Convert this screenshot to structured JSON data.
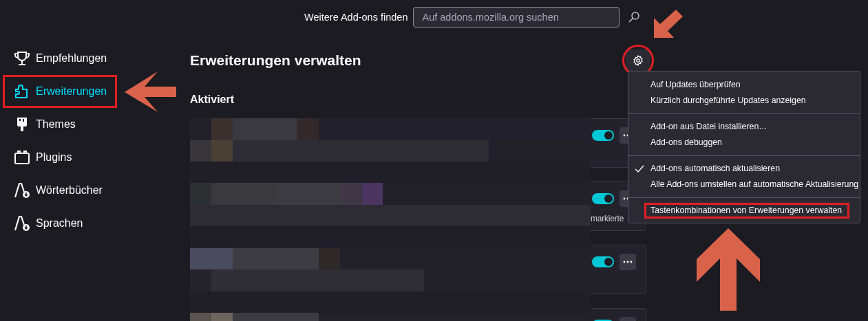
{
  "header": {
    "label": "Weitere Add-ons finden",
    "search": {
      "placeholder": "Auf addons.mozilla.org suchen"
    }
  },
  "sidebar": {
    "items": [
      {
        "label": "Empfehlungen",
        "kind": "trophy",
        "selected": false,
        "annotated": false
      },
      {
        "label": "Erweiterungen",
        "kind": "puzzle",
        "selected": true,
        "annotated": true
      },
      {
        "label": "Themes",
        "kind": "brush",
        "selected": false,
        "annotated": false
      },
      {
        "label": "Plugins",
        "kind": "plugin",
        "selected": false,
        "annotated": false
      },
      {
        "label": "Wörterbücher",
        "kind": "dictionary",
        "selected": false,
        "annotated": false
      },
      {
        "label": "Sprachen",
        "kind": "dictionary",
        "selected": false,
        "annotated": false
      }
    ]
  },
  "main": {
    "title": "Erweiterungen verwalten",
    "gear_annotated": true,
    "section": "Aktiviert",
    "cards": [
      {
        "on": true
      },
      {
        "on": true,
        "text": "markierte"
      },
      {
        "on": true
      },
      {
        "on": true
      }
    ]
  },
  "menu": {
    "groups": [
      [
        {
          "label": "Auf Updates überprüfen",
          "checked": false,
          "annotated": false
        },
        {
          "label": "Kürzlich durchgeführte Updates anzeigen",
          "checked": false,
          "annotated": false
        }
      ],
      [
        {
          "label": "Add-on aus Datei installieren…",
          "checked": false,
          "annotated": false
        },
        {
          "label": "Add-ons debuggen",
          "checked": false,
          "annotated": false
        }
      ],
      [
        {
          "label": "Add-ons automatisch aktualisieren",
          "checked": true,
          "annotated": false
        },
        {
          "label": "Alle Add-ons umstellen auf automatische Aktualisierung",
          "checked": false,
          "annotated": false
        }
      ],
      [
        {
          "label": "Tastenkombinationen von Erweiterungen verwalten",
          "checked": false,
          "annotated": true
        }
      ]
    ]
  }
}
